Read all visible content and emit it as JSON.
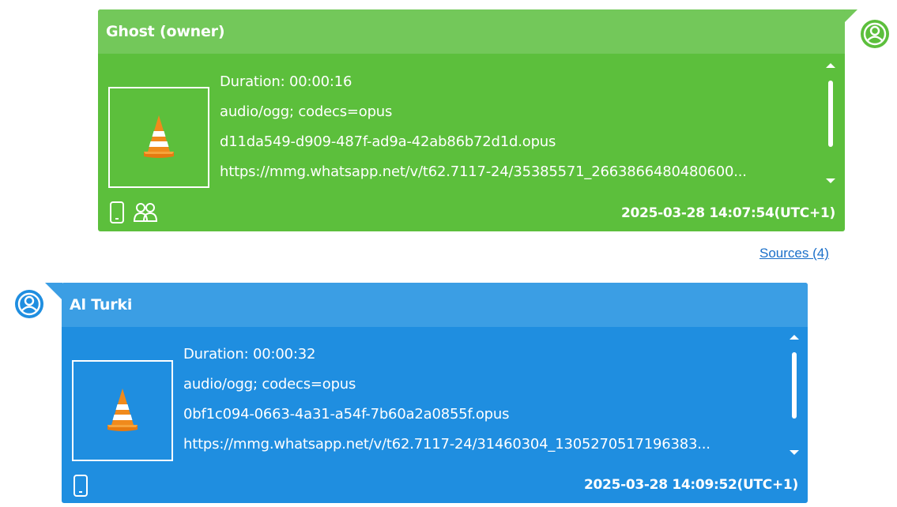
{
  "messages": [
    {
      "sender": "Ghost (owner)",
      "duration": "Duration: 00:00:16",
      "mime": "audio/ogg; codecs=opus",
      "filename": "d11da549-d909-487f-ad9a-42ab86b72d1d.opus",
      "url": "https://mmg.whatsapp.net/v/t62.7117-24/35385571_2663866480480600...",
      "timestamp": "2025-03-28 14:07:54(UTC+1)",
      "color": "#5cbf3c",
      "header_color": "#73c85a",
      "icons": [
        "phone-icon",
        "group-icon"
      ],
      "media_icon": "vlc-cone-icon",
      "avatar_icon": "user-icon",
      "avatar_color": "#5cbf3c"
    },
    {
      "sender": "Al Turki",
      "duration": "Duration: 00:00:32",
      "mime": "audio/ogg; codecs=opus",
      "filename": "0bf1c094-0663-4a31-a54f-7b60a2a0855f.opus",
      "url": "https://mmg.whatsapp.net/v/t62.7117-24/31460304_1305270517196383...",
      "timestamp": "2025-03-28 14:09:52(UTC+1)",
      "color": "#1f8ee0",
      "header_color": "#3b9ee4",
      "icons": [
        "phone-icon"
      ],
      "media_icon": "vlc-cone-icon",
      "avatar_icon": "user-icon",
      "avatar_color": "#1f8ee0"
    }
  ],
  "sources_link": "Sources (4)"
}
